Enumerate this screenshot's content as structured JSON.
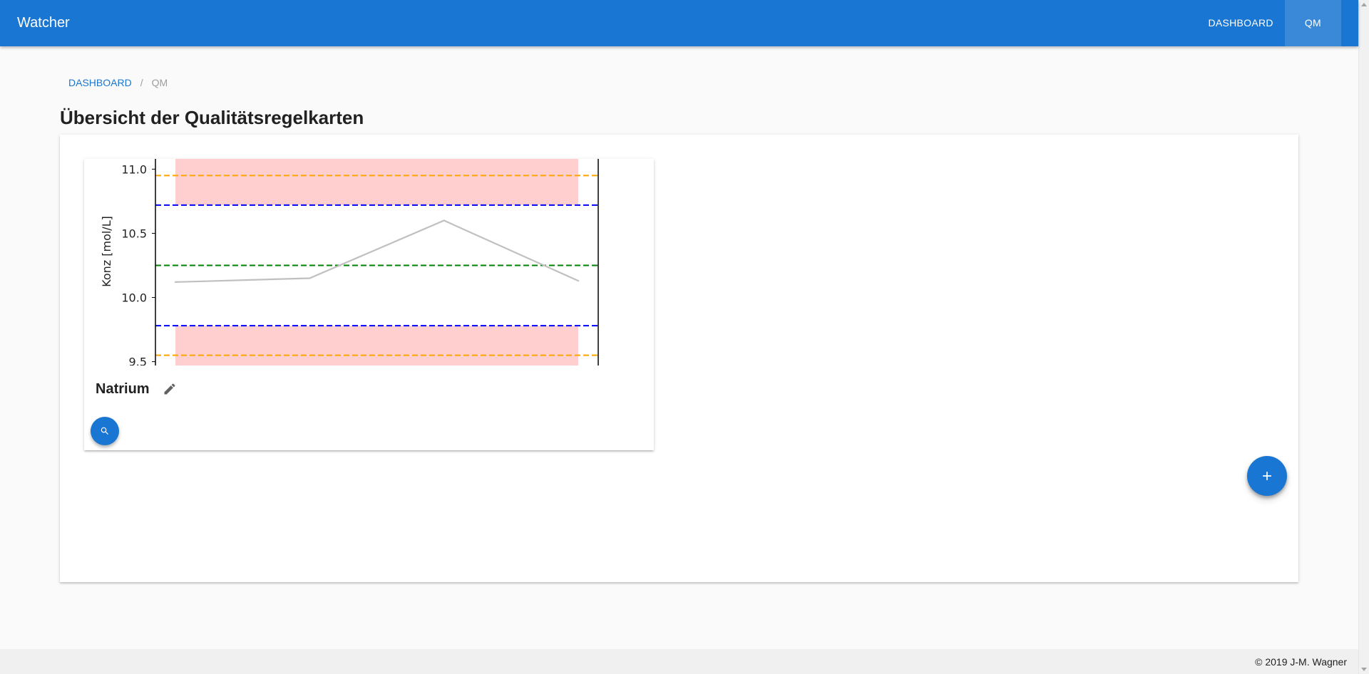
{
  "app": {
    "title": "Watcher"
  },
  "nav": {
    "items": [
      {
        "label": "DASHBOARD",
        "active": false
      },
      {
        "label": "QM",
        "active": true
      }
    ]
  },
  "breadcrumb": {
    "link": "DASHBOARD",
    "separator": "/",
    "current": "QM"
  },
  "page": {
    "title": "Übersicht der Qualitätsregelkarten"
  },
  "card": {
    "title": "Natrium",
    "edit_icon": "pencil-icon",
    "search_icon": "magnify-icon"
  },
  "fab": {
    "add_icon": "plus-icon"
  },
  "footer": {
    "text": "© 2019 J-M. Wagner"
  },
  "colors": {
    "primary": "#1976d2",
    "warning_band": "#ffcccc",
    "warning_line": "#ffa500",
    "control_line": "#0000ff",
    "mean_line": "#008000",
    "data_line": "#c0c0c0"
  },
  "chart_data": {
    "type": "line",
    "ylabel": "Konz [mol/L]",
    "ylim": [
      9.47,
      11.08
    ],
    "yticks": [
      9.5,
      10.0,
      10.5,
      11.0
    ],
    "ytick_labels": [
      "9.5",
      "10.0",
      "10.5",
      "11.0"
    ],
    "x": [
      1,
      2,
      3,
      4
    ],
    "series": [
      {
        "values": [
          10.12,
          10.15,
          10.6,
          10.13
        ]
      }
    ],
    "reference_lines": [
      {
        "kind": "upper_warning",
        "value": 10.95
      },
      {
        "kind": "upper_control",
        "value": 10.72
      },
      {
        "kind": "mean",
        "value": 10.25
      },
      {
        "kind": "lower_control",
        "value": 9.78
      },
      {
        "kind": "lower_warning",
        "value": 9.55
      }
    ],
    "bands": [
      {
        "from": 10.72,
        "to": 11.08
      },
      {
        "from": 9.47,
        "to": 9.78
      }
    ],
    "grid": false,
    "legend": "none"
  }
}
